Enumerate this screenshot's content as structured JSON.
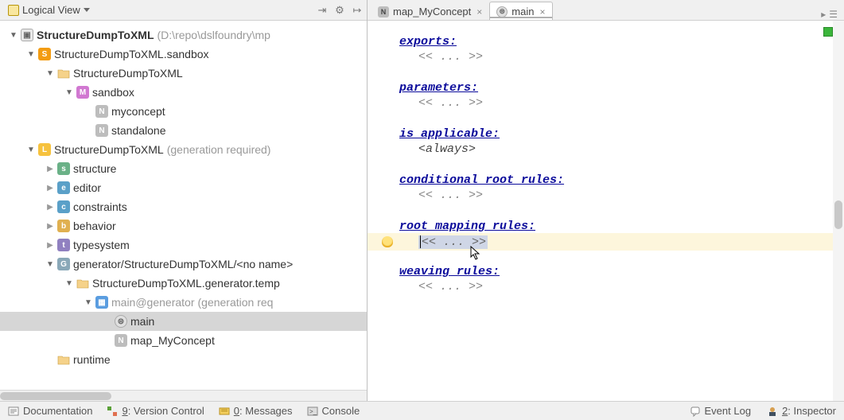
{
  "panel": {
    "title": "Logical View"
  },
  "tree": {
    "root_label": "StructureDumpToXML",
    "root_path": "(D:\\repo\\dslfoundry\\mp",
    "sandbox_label": "StructureDumpToXML.sandbox",
    "sandbox_folder": "StructureDumpToXML",
    "sandbox_m": "sandbox",
    "myconcept": "myconcept",
    "standalone": "standalone",
    "lang_label": "StructureDumpToXML",
    "lang_suffix": "(generation required)",
    "structure": "structure",
    "editor": "editor",
    "constraints": "constraints",
    "behavior": "behavior",
    "typesystem": "typesystem",
    "generator": "generator/StructureDumpToXML/<no name>",
    "gen_templates": "StructureDumpToXML.generator.temp",
    "main_gen": "main@generator",
    "main_gen_suffix": "(generation req",
    "main": "main",
    "map_concept": "map_MyConcept",
    "runtime": "runtime"
  },
  "tabs": {
    "tab1": "map_MyConcept",
    "tab2": "main"
  },
  "editor": {
    "exports": "exports:",
    "placeholder": "<< ... >>",
    "parameters": "parameters:",
    "is_applicable": "is applicable:",
    "always": "<always>",
    "cond_root": "conditional root rules:",
    "root_mapping": "root mapping rules:",
    "weaving": "weaving rules:"
  },
  "status": {
    "documentation": "Documentation",
    "vcs_u": "9",
    "vcs": ": Version Control",
    "msg_u": "0",
    "msg": ": Messages",
    "console": "Console",
    "eventlog": "Event Log",
    "insp_u": "2",
    "insp": ": Inspector"
  }
}
